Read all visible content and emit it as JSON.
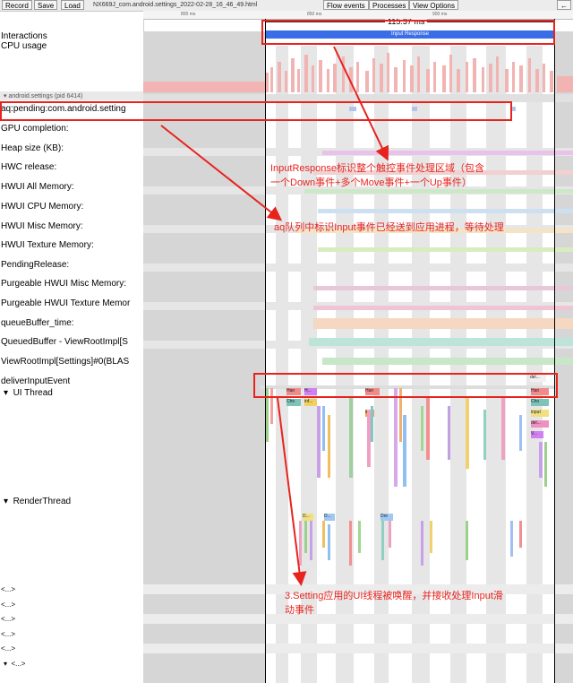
{
  "toolbar": {
    "record": "Record",
    "save": "Save",
    "load": "Load",
    "title": "NX669J_com.android.settings_2022-02-28_16_46_49.html",
    "flow_events": "Flow events",
    "processes": "Processes",
    "view_options": "View Options"
  },
  "ruler": {
    "tick_800": "800 ms",
    "tick_850": "850 ms",
    "tick_900": "900 ms"
  },
  "selection": {
    "duration": "115.37 ms",
    "input_response": "Input Response"
  },
  "tracks": {
    "interactions": "Interactions",
    "cpu_usage": "CPU usage",
    "process_header": "android.settings (pid 6414)",
    "aq_pending": "aq:pending:com.android.setting",
    "gpu_completion": "GPU completion:",
    "heap_size": "Heap size (KB):",
    "hwc_release": "HWC release:",
    "hwui_all": "HWUI All Memory:",
    "hwui_cpu": "HWUI CPU Memory:",
    "hwui_misc": "HWUI Misc Memory:",
    "hwui_texture": "HWUI Texture Memory:",
    "pending_release": "PendingRelease:",
    "purgeable_misc": "Purgeable HWUI Misc Memory:",
    "purgeable_texture": "Purgeable HWUI Texture Memor",
    "queue_buffer_time": "queueBuffer_time:",
    "queued_buffer": "QueuedBuffer - ViewRootImpl[S",
    "viewrootimpl": "ViewRootImpl[Settings]#0(BLAS",
    "deliver_input": "deliverInputEvent",
    "ui_thread": "UI Thread",
    "render_thread": "RenderThread",
    "collapsed": "<...>"
  },
  "slices": {
    "han": "Han",
    "h": "H...",
    "cho": "Cho",
    "inf": "inf...",
    "inp": "inp",
    "del": "del...",
    "input": "input",
    "v": "V...",
    "d": "D...",
    "dre": "Dre"
  },
  "annotations": {
    "a1_line1": "InputResponse标识整个触控事件处理区域（包含",
    "a1_line2": "一个Down事件+多个Move事件+一个Up事件）",
    "a2": "aq队列中标识Input事件已经送到应用进程，等待处理",
    "a3_line1": "3.Setting应用的UI线程被唤醒，并接收处理Input滑",
    "a3_line2": "动事件"
  },
  "colors": {
    "annotation": "#e8231e",
    "input_response_bar": "#3a6ee8"
  }
}
